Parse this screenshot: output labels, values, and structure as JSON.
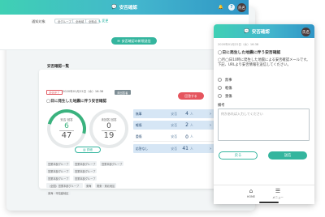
{
  "desktop": {
    "header_title": "安否確認",
    "avatar_text": "氏名",
    "filter_label": "通知対象",
    "filter_chips": [
      "全グループ",
      "全地域",
      "全拠点"
    ],
    "edit_label": "変更",
    "new_button": "安否確認の新規送信",
    "list_title": "安否確認一覧",
    "card": {
      "status": "送信完了",
      "sent_at": "2020年01月22日（水）16:38",
      "deadline": "未回答者",
      "subject": "◯日に発生した地震に伴う安否確認",
      "report_button": "回答する",
      "ring_left": {
        "label": "安否 回答",
        "value": "6",
        "total": "47"
      },
      "ring_right": {
        "label": "未回答 回答",
        "value": "0",
        "total": "19"
      },
      "detail_button": "詳細",
      "stats": [
        {
          "name": "無事",
          "unit": "安否",
          "value": "4",
          "ppl": "人"
        },
        {
          "name": "軽傷",
          "unit": "安否",
          "value": "2",
          "ppl": "人"
        },
        {
          "name": "重傷",
          "unit": "安否",
          "value": "0",
          "ppl": "人"
        },
        {
          "name": "応答なし",
          "unit": "安否",
          "value": "41",
          "ppl": "人"
        }
      ],
      "tags": [
        "営業本部グループ",
        "営業本部グループ",
        "営業本部グループ",
        "営業本部グループ",
        "営業本部グループ",
        "営業本部グループ",
        "営業本部グループ",
        "（全国）営業本部グループ",
        "東海",
        "関東・東北地区",
        "東海・甲信越地区"
      ]
    }
  },
  "mobile": {
    "header_title": "安否確認",
    "avatar_text": "氏名",
    "date": "2020年01月22日（水）16:38",
    "subject": "◯日に発生した地震に伴う安否確認",
    "body": "◯月◯日10時に発生した地震による安否確認メールです。下記、URLより安否情報を送信してください。",
    "options": [
      "無事",
      "軽傷",
      "重傷"
    ],
    "remarks_label": "備考",
    "remarks_placeholder": "何かあれば入力してください",
    "back_button": "戻る",
    "send_button": "送信",
    "nav": [
      {
        "label": "HOME"
      },
      {
        "label": "メニュー"
      }
    ]
  },
  "colors": {
    "accent": "#34b59e",
    "danger": "#e5555e",
    "header_gradient": [
      "#3fd0b4",
      "#2f95c6"
    ]
  }
}
